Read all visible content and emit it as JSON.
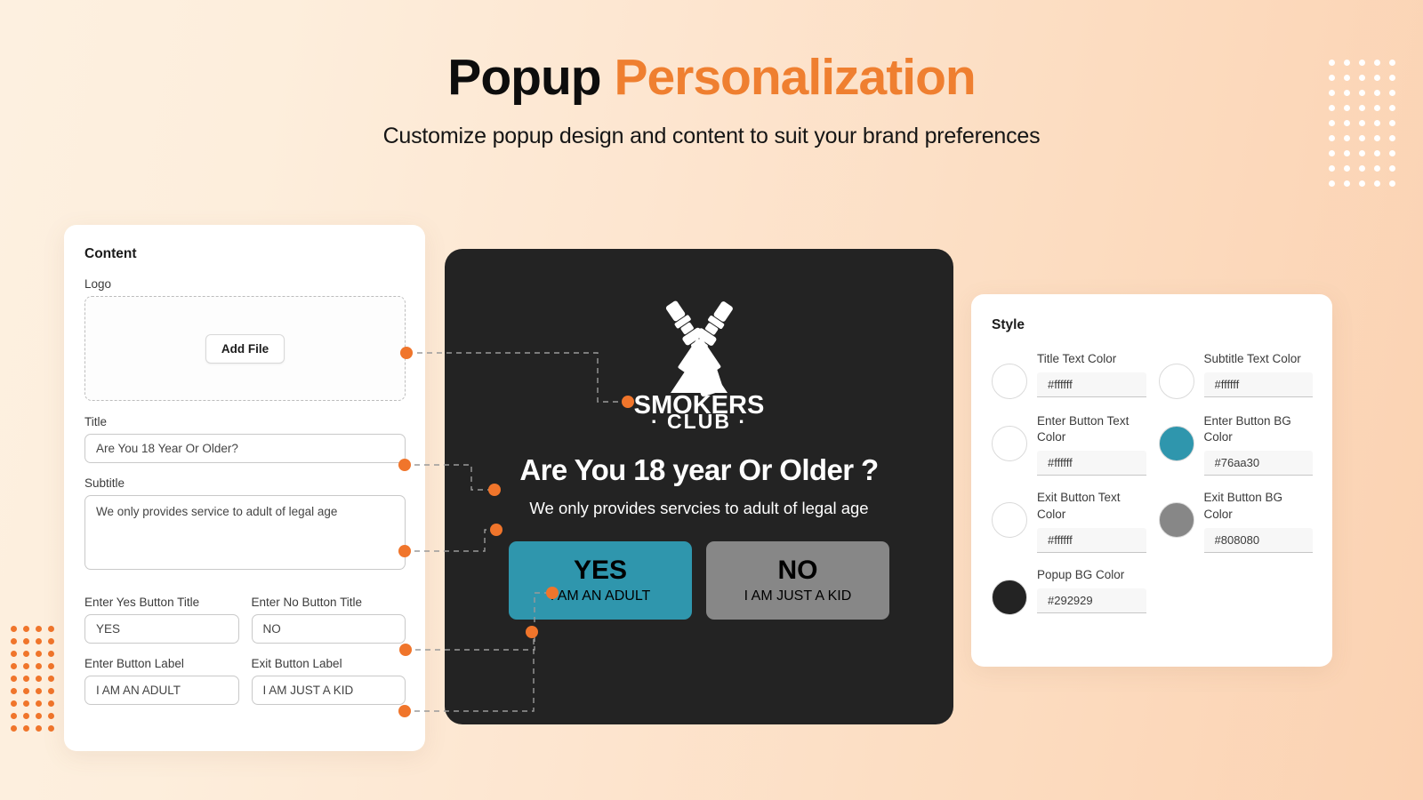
{
  "header": {
    "title_black": "Popup ",
    "title_accent": "Personalization",
    "subtitle": "Customize popup design and content to suit your brand preferences"
  },
  "theme": {
    "accent_orange": "#ef7f30",
    "dot_orange": "#f0752b",
    "page_bg_from": "#fdf0e0",
    "page_bg_to": "#fbd2b2",
    "connector_gray": "#9a9a9a"
  },
  "content_panel": {
    "heading": "Content",
    "logo": {
      "label": "Logo",
      "add_file_button": "Add File"
    },
    "title": {
      "label": "Title",
      "value": "Are You 18 Year Or Older?",
      "placeholder": "Are You 18 Year Or Older?"
    },
    "subtitle": {
      "label": "Subtitle",
      "value": "We only provides service to adult of legal age",
      "placeholder": "We only provides service to adult of legal age"
    },
    "yes_button_title": {
      "label": "Enter Yes Button Title",
      "value": "YES",
      "placeholder": "YES"
    },
    "no_button_title": {
      "label": "Enter No Button Title",
      "value": "NO",
      "placeholder": "NO"
    },
    "enter_button_label": {
      "label": "Enter Button Label",
      "value": "I AM AN ADULT",
      "placeholder": "I AM AN ADULT"
    },
    "exit_button_label": {
      "label": "Exit Button Label",
      "value": "I AM JUST A KID",
      "placeholder": "I AM JUST A KID"
    }
  },
  "popup_preview": {
    "logo_icon": "smokers-club-crossed-vapes-logo",
    "logo_line1": "SMOKERS",
    "logo_line2": "· CLUB ·",
    "title": "Are You 18 year Or Older ?",
    "subtitle": "We only provides servcies to adult of legal age",
    "yes_button": {
      "title": "YES",
      "label": "I AM AN ADULT",
      "bg": "#2f96ad",
      "text": "#ffffff"
    },
    "no_button": {
      "title": "NO",
      "label": "I AM JUST A KID",
      "bg": "#878787",
      "text": "#ffffff"
    },
    "background": "#232323"
  },
  "style_panel": {
    "heading": "Style",
    "items": [
      {
        "label": "Title Text Color",
        "value": "#ffffff",
        "placeholder": "#ffffff",
        "swatch": "#ffffff"
      },
      {
        "label": "Subtitle Text Color",
        "value": "#ffffff",
        "placeholder": "#ffffff",
        "swatch": "#ffffff"
      },
      {
        "label": "Enter Button Text Color",
        "value": "#ffffff",
        "placeholder": "#ffffff",
        "swatch": "#ffffff"
      },
      {
        "label": "Enter Button BG Color",
        "value": "#76aa30",
        "placeholder": "#76aa30",
        "swatch": "#2f96ad"
      },
      {
        "label": "Exit Button Text Color",
        "value": "#ffffff",
        "placeholder": "#ffffff",
        "swatch": "#ffffff"
      },
      {
        "label": "Exit Button BG Color",
        "value": "#808080",
        "placeholder": "#808080",
        "swatch": "#878787"
      },
      {
        "label": "Popup BG Color",
        "value": "#292929",
        "placeholder": "#292929",
        "swatch": "#232323"
      }
    ]
  },
  "decoration": {
    "top_right_dots": {
      "color": "#ffffff",
      "cols": 5,
      "rows": 9
    },
    "bottom_left_dots": {
      "color": "#f0752b",
      "cols": 4,
      "rows": 9
    }
  }
}
